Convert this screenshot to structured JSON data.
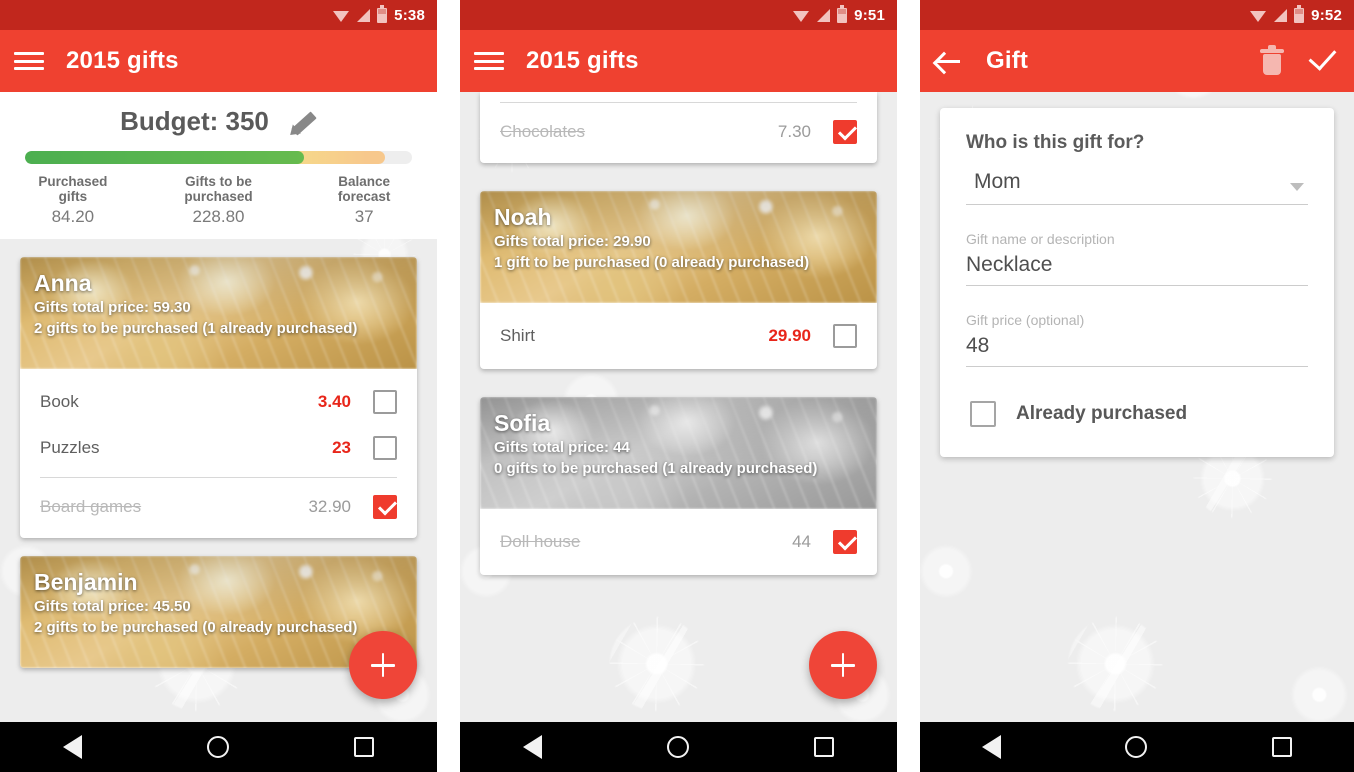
{
  "phones": [
    {
      "id": "phone-home-budget",
      "status_bar": {
        "time": "5:38",
        "icons": [
          "wifi-icon",
          "signal-icon",
          "battery-icon"
        ]
      },
      "app_bar": {
        "menu_icon": "hamburger-menu-icon",
        "title": "2015 gifts"
      },
      "budget": {
        "label": "Budget: 350",
        "edit_icon": "pencil-icon",
        "progress_percent": 72,
        "stats": [
          {
            "label_line1": "Purchased",
            "label_line2": "gifts",
            "value": "84.20"
          },
          {
            "label_line1": "Gifts to be",
            "label_line2": "purchased",
            "value": "228.80"
          },
          {
            "label_line1": "Balance",
            "label_line2": "forecast",
            "value": "37"
          }
        ]
      },
      "cards": [
        {
          "name": "Anna",
          "total": "Gifts total price: 59.30",
          "summary": "2 gifts to be purchased (1 already purchased)",
          "grayscale": false,
          "gifts": [
            {
              "name": "Book",
              "price": "3.40",
              "purchased": false
            },
            {
              "name": "Puzzles",
              "price": "23",
              "purchased": false
            },
            {
              "name": "Board games",
              "price": "32.90",
              "purchased": true
            }
          ]
        },
        {
          "name": "Benjamin",
          "total": "Gifts total price: 45.50",
          "summary": "2 gifts to be purchased (0 already purchased)",
          "grayscale": false,
          "gifts": []
        }
      ],
      "fab": {
        "icon": "plus-icon",
        "label": "+"
      },
      "nav_bar": {
        "back": "back-triangle-icon",
        "home": "home-circle-icon",
        "recents": "recents-square-icon"
      }
    },
    {
      "id": "phone-gift-list",
      "status_bar": {
        "time": "9:51",
        "icons": [
          "wifi-icon",
          "signal-icon",
          "battery-icon"
        ]
      },
      "app_bar": {
        "menu_icon": "hamburger-menu-icon",
        "title": "2015 gifts"
      },
      "partial_card": {
        "gifts": [
          {
            "name": "Chocolates",
            "price": "7.30",
            "purchased": true
          }
        ]
      },
      "cards": [
        {
          "name": "Noah",
          "total": "Gifts total price: 29.90",
          "summary": "1 gift to be purchased (0 already purchased)",
          "grayscale": false,
          "gifts": [
            {
              "name": "Shirt",
              "price": "29.90",
              "purchased": false
            }
          ]
        },
        {
          "name": "Sofia",
          "total": "Gifts total price: 44",
          "summary": "0 gifts to be purchased (1 already purchased)",
          "grayscale": true,
          "gifts": [
            {
              "name": "Doll house",
              "price": "44",
              "purchased": true
            }
          ]
        }
      ],
      "fab": {
        "icon": "plus-icon",
        "label": "+"
      },
      "nav_bar": {
        "back": "back-triangle-icon",
        "home": "home-circle-icon",
        "recents": "recents-square-icon"
      }
    },
    {
      "id": "phone-gift-edit",
      "status_bar": {
        "time": "9:52",
        "icons": [
          "wifi-icon",
          "signal-icon",
          "battery-icon"
        ]
      },
      "app_bar": {
        "back_icon": "back-arrow-icon",
        "title": "Gift",
        "delete_icon": "trash-icon",
        "save_icon": "check-icon"
      },
      "form": {
        "question": "Who is this gift for?",
        "recipient": {
          "value": "Mom",
          "caret_icon": "chevron-down-icon"
        },
        "gift_name": {
          "label": "Gift name or description",
          "value": "Necklace"
        },
        "gift_price": {
          "label": "Gift price (optional)",
          "value": "48"
        },
        "already_purchased": {
          "label": "Already purchased",
          "checked": false
        }
      },
      "nav_bar": {
        "back": "back-triangle-icon",
        "home": "home-circle-icon",
        "recents": "recents-square-icon"
      }
    }
  ],
  "colors": {
    "status_bar": "#c1271d",
    "app_bar": "#ef4130",
    "accent_red": "#ef3b2d",
    "price_red": "#e8261a",
    "fab": "#ef4538",
    "progress_green": "#4caf50",
    "background": "#ededed"
  }
}
